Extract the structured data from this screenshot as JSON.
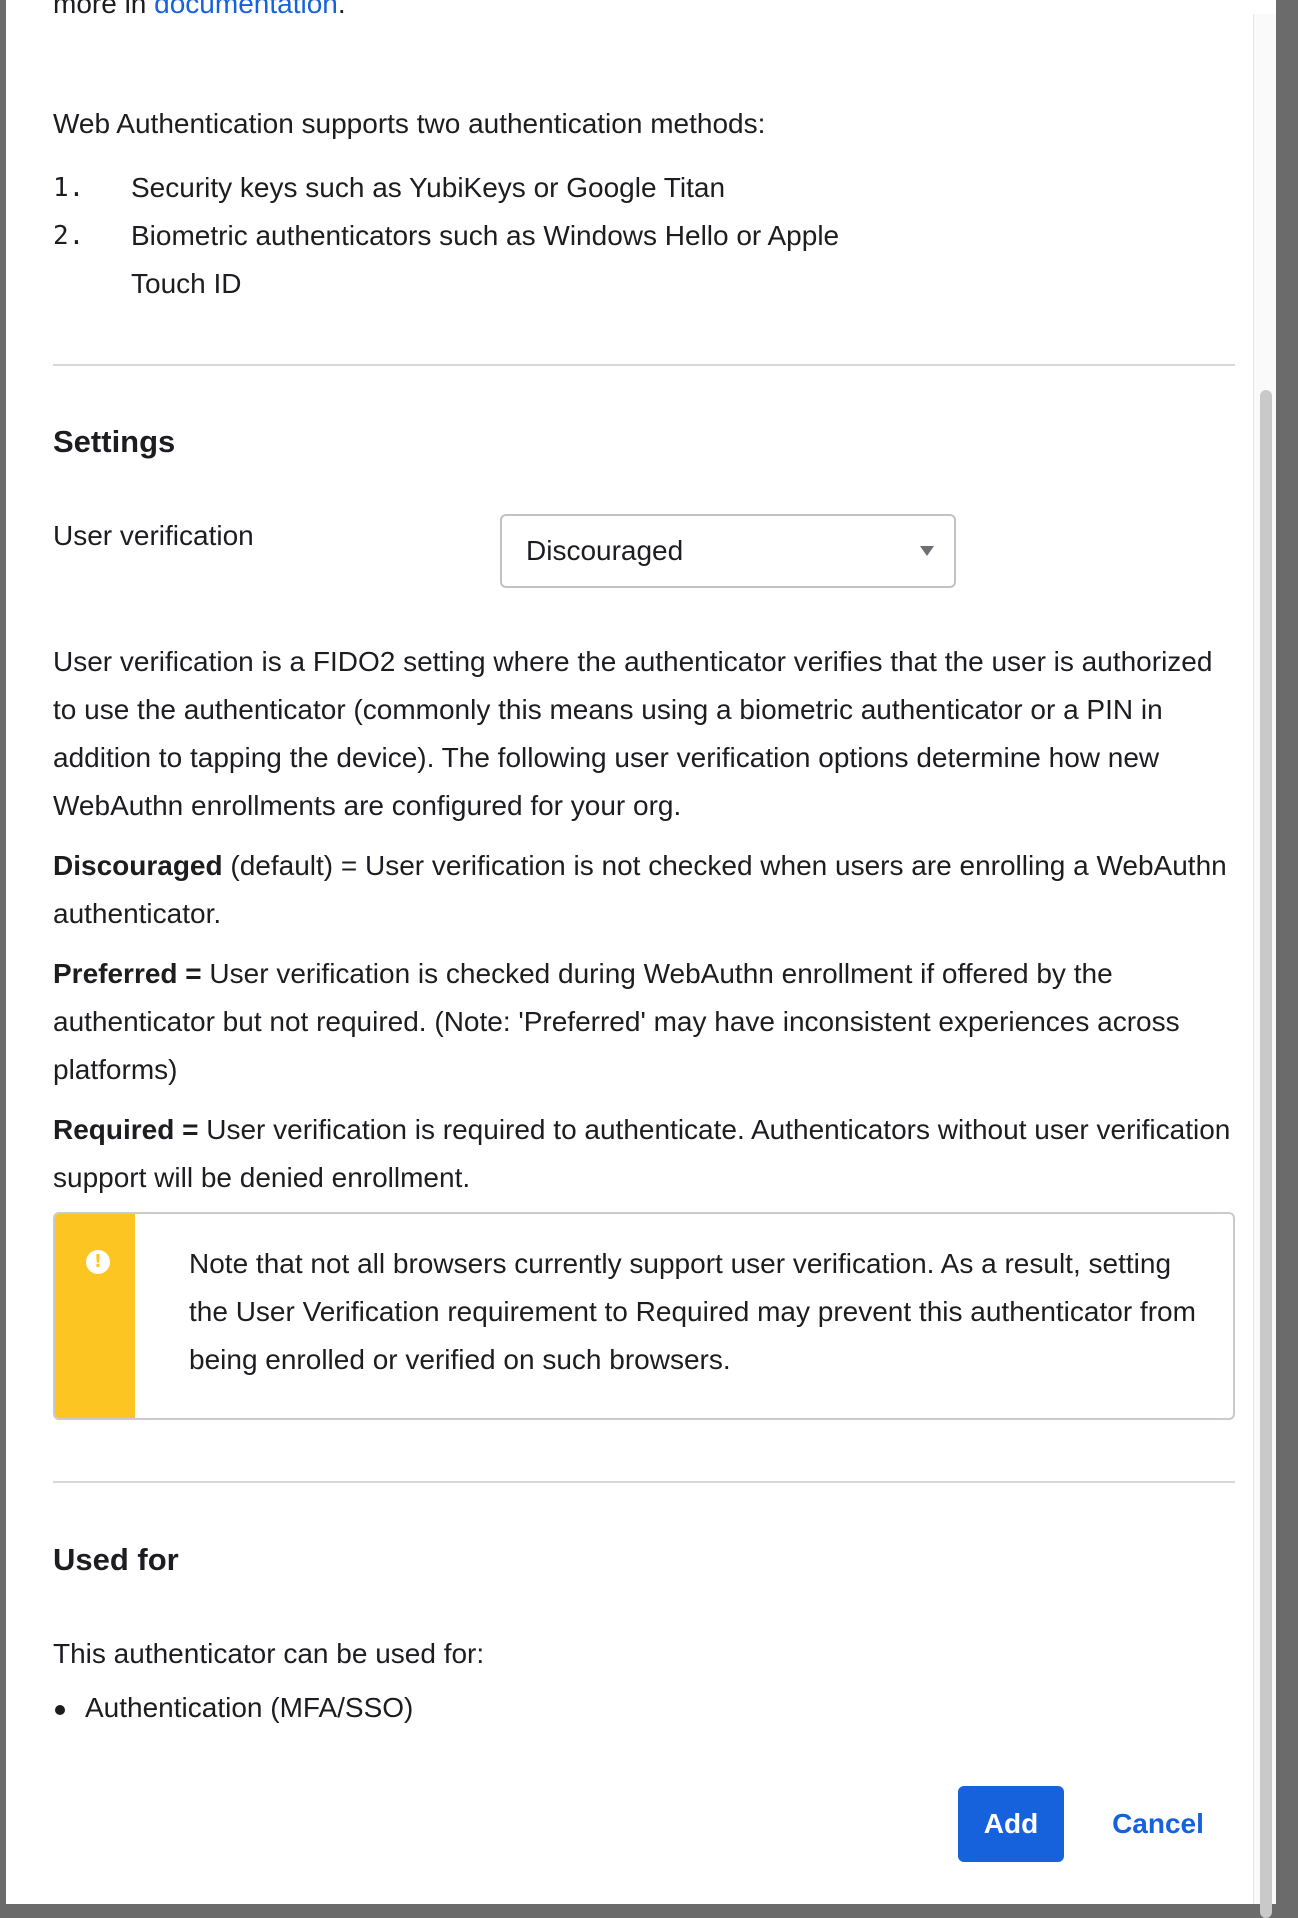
{
  "intro": {
    "doc_line_prefix": "more in ",
    "doc_link": "documentation",
    "doc_line_suffix": ".",
    "methods_heading": "Web Authentication supports two authentication methods:",
    "methods": [
      {
        "num": "1.",
        "text": "Security keys such as YubiKeys or Google Titan"
      },
      {
        "num": "2.",
        "text": "Biometric authenticators such as Windows Hello or Apple Touch ID"
      }
    ]
  },
  "settings": {
    "heading": "Settings",
    "user_verification_label": "User verification",
    "user_verification_value": "Discouraged",
    "description": "User verification is a FIDO2 setting where the authenticator verifies that the user is authorized to use the authenticator (commonly this means using a biometric authenticator or a PIN in addition to tapping the device). The following user verification options determine how new WebAuthn enrollments are configured for your org.",
    "discouraged_term": "Discouraged",
    "discouraged_text": " (default) = User verification is not checked when users are enrolling a WebAuthn authenticator.",
    "preferred_term": "Preferred =",
    "preferred_text": " User verification is checked during WebAuthn enrollment if offered by the authenticator but not required. (Note: 'Preferred' may have inconsistent experiences across platforms)",
    "required_term": "Required =",
    "required_text": " User verification is required to authenticate. Authenticators without user verification support will be denied enrollment.",
    "warning_icon": "warning-icon",
    "warning_text": "Note that not all browsers currently support user verification. As a result, setting the User Verification requirement to Required may prevent this authenticator from being enrolled or verified on such browsers."
  },
  "used_for": {
    "heading": "Used for",
    "intro": "This authenticator can be used for:",
    "items": [
      "Authentication (MFA/SSO)"
    ]
  },
  "actions": {
    "add_label": "Add",
    "cancel_label": "Cancel"
  },
  "colors": {
    "link": "#1662dd",
    "primary_button": "#1662dd",
    "warning": "#fdc521"
  }
}
